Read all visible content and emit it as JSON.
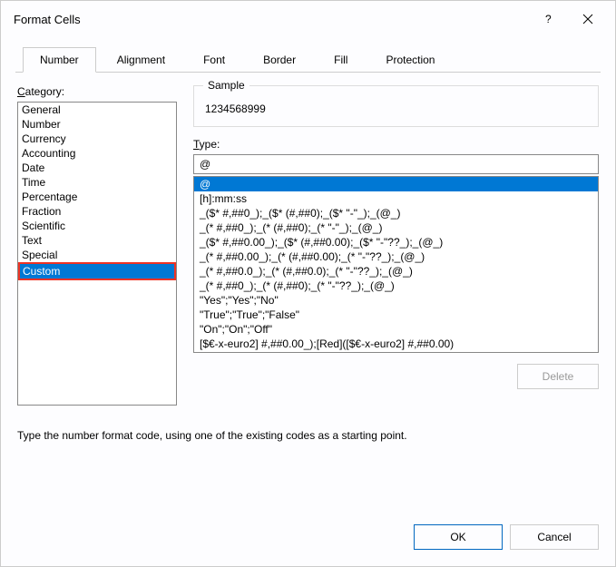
{
  "titlebar": {
    "title": "Format Cells"
  },
  "tabs": [
    {
      "label": "Number",
      "active": true
    },
    {
      "label": "Alignment",
      "active": false
    },
    {
      "label": "Font",
      "active": false
    },
    {
      "label": "Border",
      "active": false
    },
    {
      "label": "Fill",
      "active": false
    },
    {
      "label": "Protection",
      "active": false
    }
  ],
  "category": {
    "label_prefix": "C",
    "label_rest": "ategory:",
    "items": [
      "General",
      "Number",
      "Currency",
      "Accounting",
      "Date",
      "Time",
      "Percentage",
      "Fraction",
      "Scientific",
      "Text",
      "Special",
      "Custom"
    ],
    "selected": "Custom"
  },
  "sample": {
    "legend": "Sample",
    "value": "1234568999"
  },
  "type": {
    "label_prefix": "T",
    "label_rest": "ype:",
    "value": "@",
    "items": [
      "@",
      "[h]:mm:ss",
      "_($* #,##0_);_($* (#,##0);_($* \"-\"_);_(@_)",
      "_(* #,##0_);_(* (#,##0);_(* \"-\"_);_(@_)",
      "_($* #,##0.00_);_($* (#,##0.00);_($* \"-\"??_);_(@_)",
      "_(* #,##0.00_);_(* (#,##0.00);_(* \"-\"??_);_(@_)",
      "_(* #,##0.0_);_(* (#,##0.0);_(* \"-\"??_);_(@_)",
      "_(* #,##0_);_(* (#,##0);_(* \"-\"??_);_(@_)",
      "\"Yes\";\"Yes\";\"No\"",
      "\"True\";\"True\";\"False\"",
      "\"On\";\"On\";\"Off\"",
      "[$€-x-euro2] #,##0.00_);[Red]([$€-x-euro2] #,##0.00)"
    ],
    "selected_index": 0
  },
  "delete_label": "Delete",
  "hint": "Type the number format code, using one of the existing codes as a starting point.",
  "buttons": {
    "ok": "OK",
    "cancel": "Cancel"
  }
}
